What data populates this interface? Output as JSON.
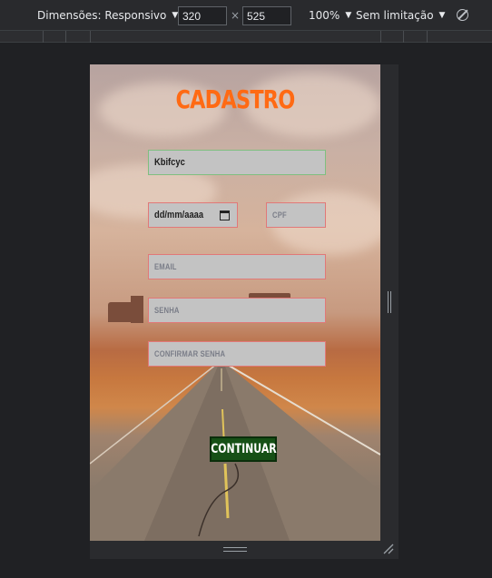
{
  "devtools": {
    "dimensions_label": "Dimensões: Responsivo",
    "width_value": "320",
    "height_value": "525",
    "times": "×",
    "zoom_label": "100%",
    "throttle_label": "Sem limitação",
    "icons": [
      "rotate-icon",
      "resize-grip-icon"
    ]
  },
  "form": {
    "title": "CADASTRO",
    "name_value": "Kbifcyc",
    "date_placeholder": "dd/mm/aaaa",
    "cpf_placeholder": "CPF",
    "email_placeholder": "EMAIL",
    "password_placeholder": "SENHA",
    "confirm_password_placeholder": "CONFIRMAR SENHA",
    "submit_label": "CONTINUAR"
  },
  "colors": {
    "title": "#ff6a14",
    "input_bg": "#c3c3c3",
    "invalid_border": "#e17878",
    "valid_border": "#7fbf7f",
    "button_bg": "#165016"
  }
}
